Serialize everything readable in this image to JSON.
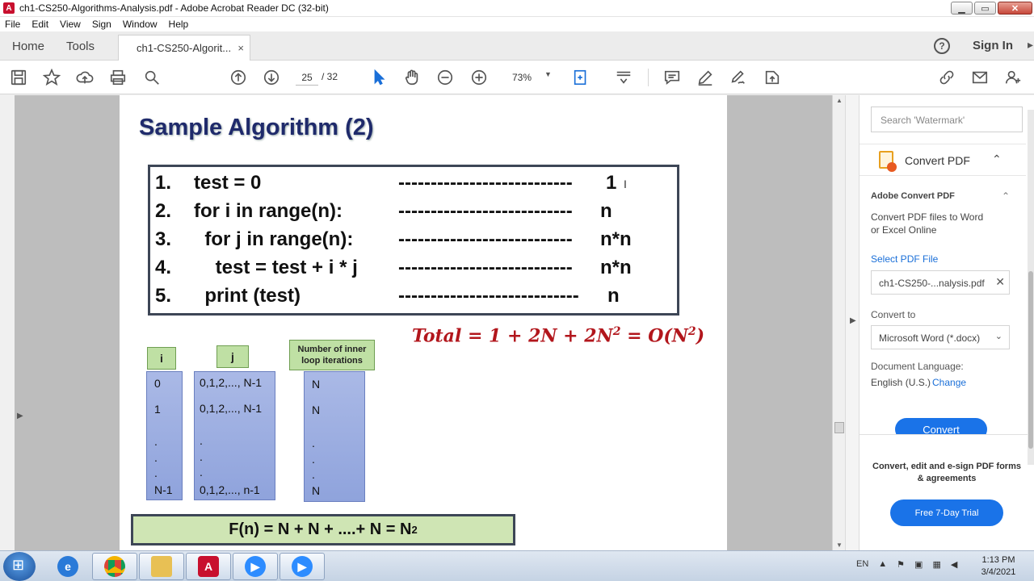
{
  "window": {
    "title": "ch1-CS250-Algorithms-Analysis.pdf - Adobe Acrobat Reader DC (32-bit)",
    "app_icon_letter": "A",
    "minimize": "▁",
    "maximize": "▭",
    "close": "✕"
  },
  "menu": [
    "File",
    "Edit",
    "View",
    "Sign",
    "Window",
    "Help"
  ],
  "tabs": {
    "home": "Home",
    "tools": "Tools",
    "document": "ch1-CS250-Algorit...",
    "document_close": "×",
    "help_glyph": "?",
    "sign_in": "Sign In"
  },
  "toolbar": {
    "current_page": "25",
    "page_total": "/ 32",
    "zoom": "73%",
    "icons": [
      "save-icon",
      "bookmark-star-icon",
      "upload-cloud-icon",
      "print-icon",
      "search-icon",
      "prev-page-icon",
      "next-page-icon",
      "select-cursor-icon",
      "hand-icon",
      "zoom-out-icon",
      "zoom-in-icon",
      "fit-page-icon",
      "scroll-mode-icon",
      "comment-icon",
      "highlight-pen-icon",
      "fill-sign-icon",
      "more-tools-icon",
      "link-icon",
      "email-icon",
      "add-user-icon"
    ]
  },
  "slide": {
    "title": "Sample Algorithm (2)",
    "code_lines": [
      {
        "num": "1.",
        "code": "test = 0",
        "dashes": "---------------------------",
        "cost": "1"
      },
      {
        "num": "2.",
        "code": "for i in range(n):",
        "dashes": "---------------------------",
        "cost": "n"
      },
      {
        "num": "3.",
        "code": "  for j in range(n):",
        "dashes": "---------------------------",
        "cost": "n*n"
      },
      {
        "num": "4.",
        "code": "    test = test + i * j",
        "dashes": "---------------------------",
        "cost": "n*n"
      },
      {
        "num": "5.",
        "code": "  print (test)",
        "dashes": "----------------------------",
        "cost": "n"
      }
    ],
    "total_prefix": "Total = 1 + 2N + 2N",
    "total_exp": "2",
    "total_mid": " = O(N",
    "total_exp2": "2",
    "total_suffix": ")",
    "columns": {
      "i": {
        "header": "i",
        "values": [
          "0",
          "1",
          ".",
          ".",
          ".",
          "N-1"
        ]
      },
      "j": {
        "header": "j",
        "values": [
          "0,1,2,..., N-1",
          "0,1,2,..., N-1",
          ".",
          ".",
          ".",
          "0,1,2,..., n-1"
        ]
      },
      "inner": {
        "header_line1": "Number of inner",
        "header_line2": "loop iterations",
        "values": [
          "N",
          "N",
          ".",
          ".",
          ".",
          "N"
        ]
      }
    },
    "fn_text": "F(n) = N + N + ....+ N = N",
    "fn_exp": "2"
  },
  "right_panel": {
    "search_placeholder": "Search 'Watermark'",
    "convert_pdf": "Convert PDF",
    "adobe_convert_title": "Adobe Convert PDF",
    "adobe_convert_desc": "Convert PDF files to Word or Excel Online",
    "select_pdf_file": "Select PDF File",
    "file_name": "ch1-CS250-...nalysis.pdf",
    "convert_to": "Convert to",
    "format": "Microsoft Word (*.docx)",
    "document_language": "Document Language:",
    "language": "English (U.S.)",
    "change": "Change",
    "convert_button": "Convert",
    "promo": "Convert, edit and e-sign PDF forms & agreements",
    "trial_button": "Free 7-Day Trial"
  },
  "taskbar": {
    "lang": "EN",
    "time": "1:13 PM",
    "date": "3/4/2021"
  },
  "colors": {
    "slide_title": "#1f2a6b",
    "total_formula": "#b2161c",
    "green_header": "#bfe0a4",
    "blue_column": "#8fa3dc",
    "accent_blue": "#1a73e8"
  }
}
